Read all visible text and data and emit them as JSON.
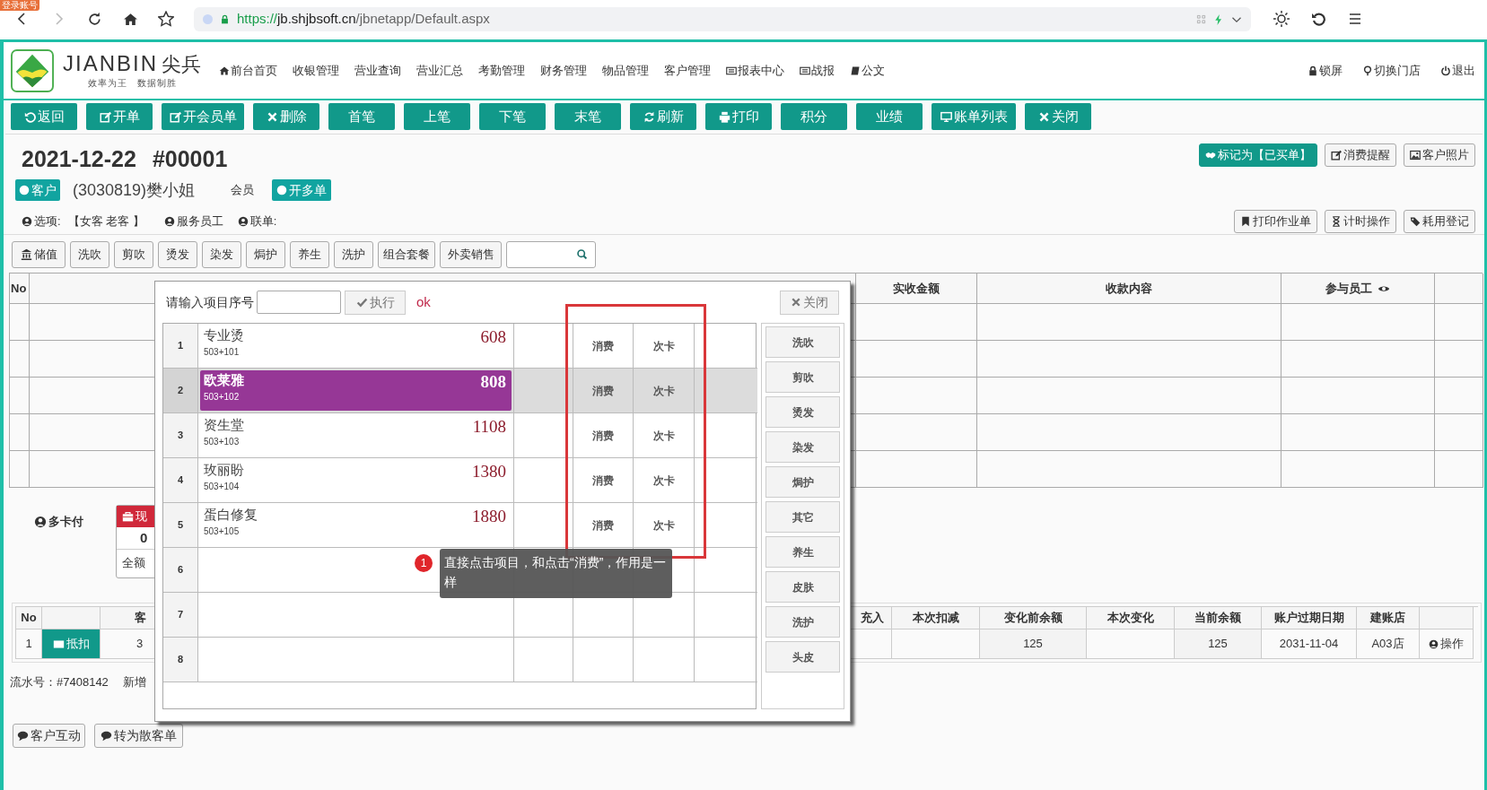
{
  "corner_badge": "登录账号",
  "browser": {
    "url_parts": [
      {
        "kind": "scheme",
        "text": "https://"
      },
      {
        "kind": "host",
        "text": "jb.shjbsoft.cn"
      },
      {
        "kind": "path",
        "text": "/jbnetapp/Default.aspx"
      }
    ]
  },
  "header": {
    "logo": {
      "name": "JIANBIN",
      "name_cn": "尖兵",
      "slogan": "效率为王   数据制胜"
    },
    "nav": [
      {
        "label": "前台首页"
      },
      {
        "label": "收银管理"
      },
      {
        "label": "营业查询"
      },
      {
        "label": "营业汇总"
      },
      {
        "label": "考勤管理"
      },
      {
        "label": "财务管理"
      },
      {
        "label": "物品管理"
      },
      {
        "label": "客户管理"
      },
      {
        "label": "报表中心"
      },
      {
        "label": "战报"
      },
      {
        "label": "公文"
      }
    ],
    "actions": [
      {
        "label": "锁屏"
      },
      {
        "label": "切换门店"
      },
      {
        "label": "退出"
      }
    ]
  },
  "toolbar": [
    {
      "label": "返回"
    },
    {
      "label": "开单"
    },
    {
      "label": "开会员单"
    },
    {
      "label": "删除"
    },
    {
      "label": "首笔"
    },
    {
      "label": "上笔"
    },
    {
      "label": "下笔"
    },
    {
      "label": "末笔"
    },
    {
      "label": "刷新"
    },
    {
      "label": "打印"
    },
    {
      "label": "积分"
    },
    {
      "label": "业绩"
    },
    {
      "label": "账单列表"
    },
    {
      "label": "关闭"
    }
  ],
  "order": {
    "date": "2021-12-22",
    "number": "#00001",
    "buttons": [
      {
        "label": "标记为【已买单】"
      },
      {
        "label": "消费提醒"
      },
      {
        "label": "客户照片"
      }
    ],
    "customer_badge": "客户",
    "customer": "(3030819)樊小姐",
    "member": "会员",
    "multi_order": "开多单",
    "options_label": "选项:",
    "options_value": "【女客 老客 】",
    "staff": "服务员工",
    "linked": "联单:",
    "tools": [
      {
        "label": "打印作业单"
      },
      {
        "label": "计时操作"
      },
      {
        "label": "耗用登记"
      }
    ]
  },
  "categories": [
    {
      "label": "储值"
    },
    {
      "label": "洗吹"
    },
    {
      "label": "剪吹"
    },
    {
      "label": "烫发"
    },
    {
      "label": "染发"
    },
    {
      "label": "焗护"
    },
    {
      "label": "养生"
    },
    {
      "label": "洗护"
    },
    {
      "label": "组合套餐"
    },
    {
      "label": "外卖销售"
    }
  ],
  "main_table": {
    "columns": [
      "No",
      "实收金额",
      "收款内容",
      "参与员工"
    ]
  },
  "payment": {
    "multi_card": "多卡付",
    "cash_title": "现",
    "cash_amount": "0",
    "cash_button": "全额"
  },
  "accounts_table": {
    "columns_left": [
      "No",
      "客"
    ],
    "columns_right": [
      "充入",
      "本次扣减",
      "变化前余额",
      "本次变化",
      "当前余额",
      "账户过期日期",
      "建账店"
    ],
    "row": {
      "no": "1",
      "action": "抵扣",
      "column_3": "3",
      "cells": [
        "",
        "",
        "125",
        "",
        "125",
        "2031-11-04",
        "A03店"
      ],
      "operate": "操作"
    }
  },
  "footer": {
    "serial": "流水号：#7408142",
    "added": "新增",
    "buttons": [
      "客户互动",
      "转为散客单"
    ]
  },
  "modal": {
    "prompt": "请输入项目序号",
    "execute": "执行",
    "status": "ok",
    "close": "关闭",
    "items": [
      {
        "no": "1",
        "name": "专业烫",
        "code": "503+101",
        "price": "608",
        "actions": [
          "消费",
          "次卡"
        ],
        "selected": false
      },
      {
        "no": "2",
        "name": "欧莱雅",
        "code": "503+102",
        "price": "808",
        "actions": [
          "消费",
          "次卡"
        ],
        "selected": true
      },
      {
        "no": "3",
        "name": "资生堂",
        "code": "503+103",
        "price": "1108",
        "actions": [
          "消费",
          "次卡"
        ],
        "selected": false
      },
      {
        "no": "4",
        "name": "玫丽盼",
        "code": "503+104",
        "price": "1380",
        "actions": [
          "消费",
          "次卡"
        ],
        "selected": false
      },
      {
        "no": "5",
        "name": "蛋白修复",
        "code": "503+105",
        "price": "1880",
        "actions": [
          "消费",
          "次卡"
        ],
        "selected": false
      },
      {
        "no": "6",
        "selected": false
      },
      {
        "no": "7",
        "selected": false
      },
      {
        "no": "8",
        "selected": false
      }
    ],
    "categories": [
      "洗吹",
      "剪吹",
      "烫发",
      "染发",
      "焗护",
      "其它",
      "养生",
      "皮肤",
      "洗护",
      "头皮"
    ],
    "tip_number": "1",
    "tip": "直接点击项目，和点击“消费”，作用是一样"
  }
}
